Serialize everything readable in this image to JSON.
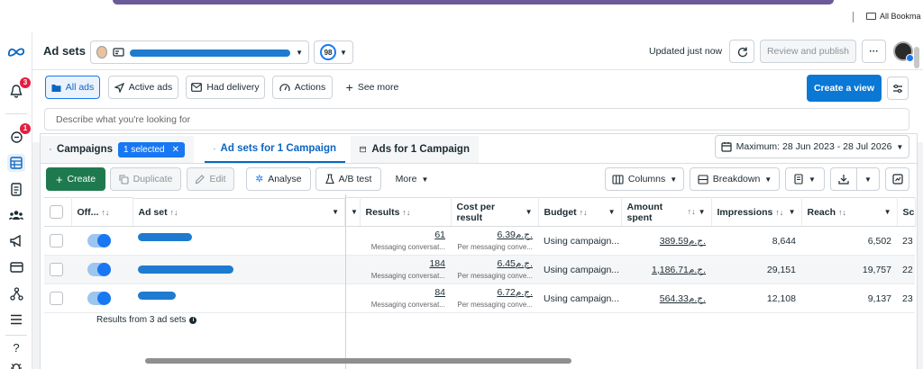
{
  "browser": {
    "bookmarks_label": "All Bookma"
  },
  "sidebar": {
    "notifications_badge": "3",
    "alerts_badge": "1"
  },
  "header": {
    "title": "Ad sets",
    "account_name": "",
    "score": "98",
    "updated_text": "Updated just now",
    "review_label": "Review and publish",
    "more_label": "···"
  },
  "filters": {
    "buttons": [
      "All ads",
      "Active ads",
      "Had delivery",
      "Actions"
    ],
    "see_more": "See more",
    "create_view": "Create a view",
    "search_placeholder": "Describe what you're looking for"
  },
  "tabs": {
    "campaigns": "Campaigns",
    "campaigns_chip": "1 selected",
    "adsets": "Ad sets for 1 Campaign",
    "ads": "Ads for 1 Campaign"
  },
  "date_range": "Maximum: 28 Jun 2023 - 28 Jul 2026",
  "toolbar": {
    "create": "Create",
    "duplicate": "Duplicate",
    "edit": "Edit",
    "analyse": "Analyse",
    "abtest": "A/B test",
    "more": "More",
    "columns": "Columns",
    "breakdown": "Breakdown"
  },
  "table": {
    "headers": {
      "offon": "Off...",
      "adset": "Ad set",
      "results": "Results",
      "cost_line1": "Cost per",
      "cost_line2": "result",
      "budget": "Budget",
      "amount_line1": "Amount",
      "amount_line2": "spent",
      "impressions": "Impressions",
      "reach": "Reach",
      "next": "Sc"
    },
    "rows": [
      {
        "results": "61",
        "results_sub": "Messaging conversat...",
        "cost": "6.39ج.م.",
        "cost_sub": "Per messaging conve...",
        "budget": "Using campaign...",
        "amount": "389.59ج.م.",
        "impressions": "8,644",
        "reach": "6,502",
        "next": "23"
      },
      {
        "results": "184",
        "results_sub": "Messaging conversat...",
        "cost": "6.45ج.م.",
        "cost_sub": "Per messaging conve...",
        "budget": "Using campaign...",
        "amount": "1,186.71ج.م.",
        "impressions": "29,151",
        "reach": "19,757",
        "next": "22"
      },
      {
        "results": "84",
        "results_sub": "Messaging conversat...",
        "cost": "6.72ج.م.",
        "cost_sub": "Per messaging conve...",
        "budget": "Using campaign...",
        "amount": "564.33ج.م.",
        "impressions": "12,108",
        "reach": "9,137",
        "next": "23"
      }
    ],
    "summary": "Results from 3 ad sets"
  }
}
